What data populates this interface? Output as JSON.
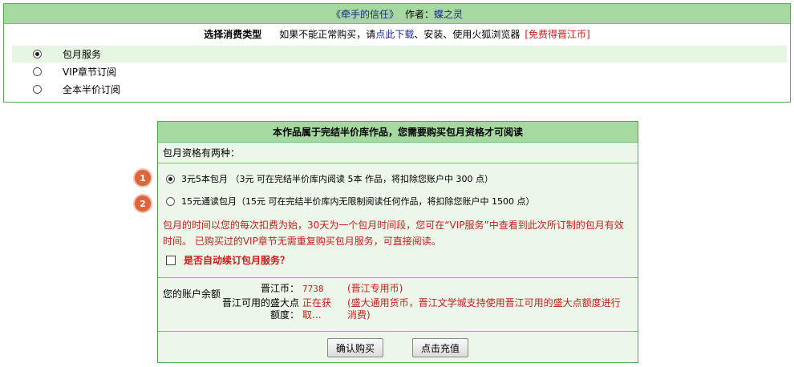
{
  "top": {
    "book_title": "《牵手的信任》",
    "author_label": "作者：",
    "author_name": "蝶之灵",
    "select_label": "选择消费类型",
    "hint_prefix": "如果不能正常购买，请",
    "download_link": "点此下载",
    "hint_suffix": "、安装、使用火狐浏览器",
    "free_link": "[免费得晋江币]",
    "options": [
      {
        "label": "包月服务",
        "checked": true
      },
      {
        "label": "VIP章节订阅",
        "checked": false
      },
      {
        "label": "全本半价订阅",
        "checked": false
      }
    ]
  },
  "center": {
    "header": "本作品属于完结半价库作品，您需要购买包月资格才可阅读",
    "intro": "包月资格有两种：",
    "plans": [
      {
        "label": "3元5本包月 （3元  可在完结半价库内阅读  5本  作品，将扣除您账户中  300  点）",
        "checked": true,
        "badge": "1"
      },
      {
        "label": "15元通读包月（15元  可在完结半价库内无限制阅读任何作品，将扣除您账户中  1500  点）",
        "checked": false,
        "badge": "2"
      }
    ],
    "notice_line1": "包月的时间以您的每次扣费为始，30天为一个包月时间段，您可在“VIP服务”中查看到此次所订制的包月有效",
    "notice_line2": "时间。  已购买过的VIP章节无需重复购买包月服务，可直接阅读。",
    "auto_renew_label": "是否自动续订包月服务？",
    "balance": {
      "title": "您的账户余额",
      "jjb_label": "晋江币：",
      "jjb_value": "7738",
      "jjb_note": "(晋江专用币)",
      "sd_label": "晋江可用的盛大点额度：",
      "sd_value": "正在获取...",
      "sd_note": "(盛大通用货币，晋江文学城支持使用晋江可用的盛大点额度进行消费)"
    },
    "buttons": {
      "confirm": "确认购买",
      "recharge": "点击充值"
    }
  }
}
